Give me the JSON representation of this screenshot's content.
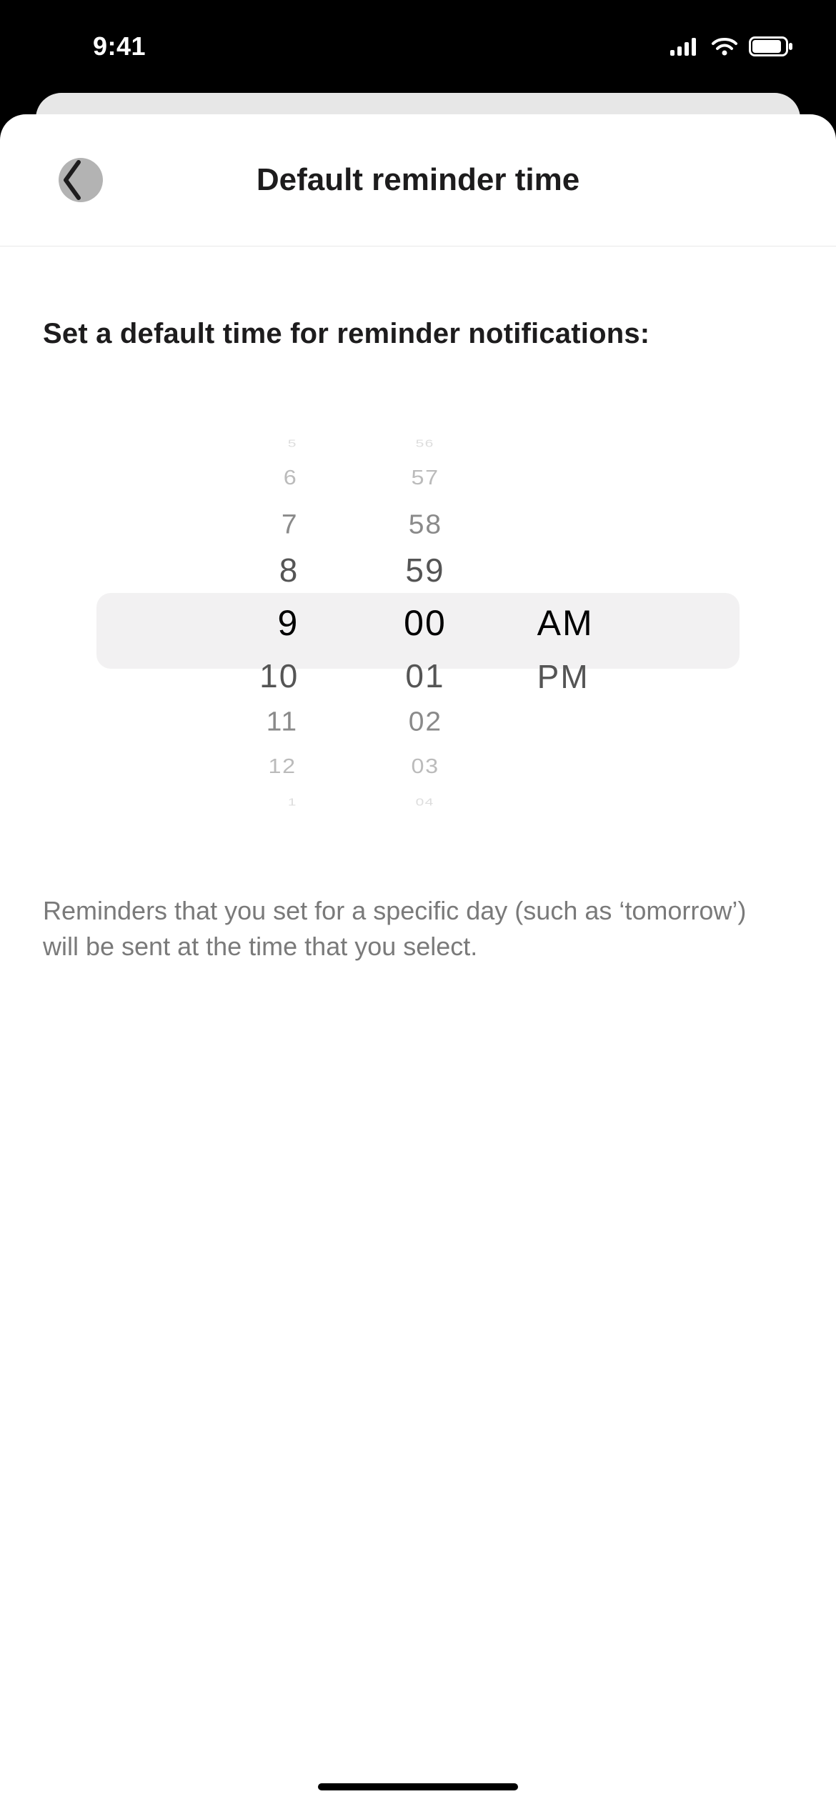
{
  "status": {
    "time": "9:41"
  },
  "header": {
    "title": "Default reminder time"
  },
  "heading": "Set a default time for reminder notifications:",
  "picker": {
    "hours": {
      "fadeTop": "5",
      "edgeTop": "6",
      "farTop": "7",
      "nearTop": "8",
      "selected": "9",
      "nearBot": "10",
      "farBot": "11",
      "edgeBot": "12",
      "fadeBot": "1"
    },
    "minutes": {
      "fadeTop": "56",
      "edgeTop": "57",
      "farTop": "58",
      "nearTop": "59",
      "selected": "00",
      "nearBot": "01",
      "farBot": "02",
      "edgeBot": "03",
      "fadeBot": "04"
    },
    "period": {
      "selected": "AM",
      "other": "PM"
    }
  },
  "description": "Reminders that you set for a specific day (such as ‘tomorrow’) will be sent at the time that you select."
}
